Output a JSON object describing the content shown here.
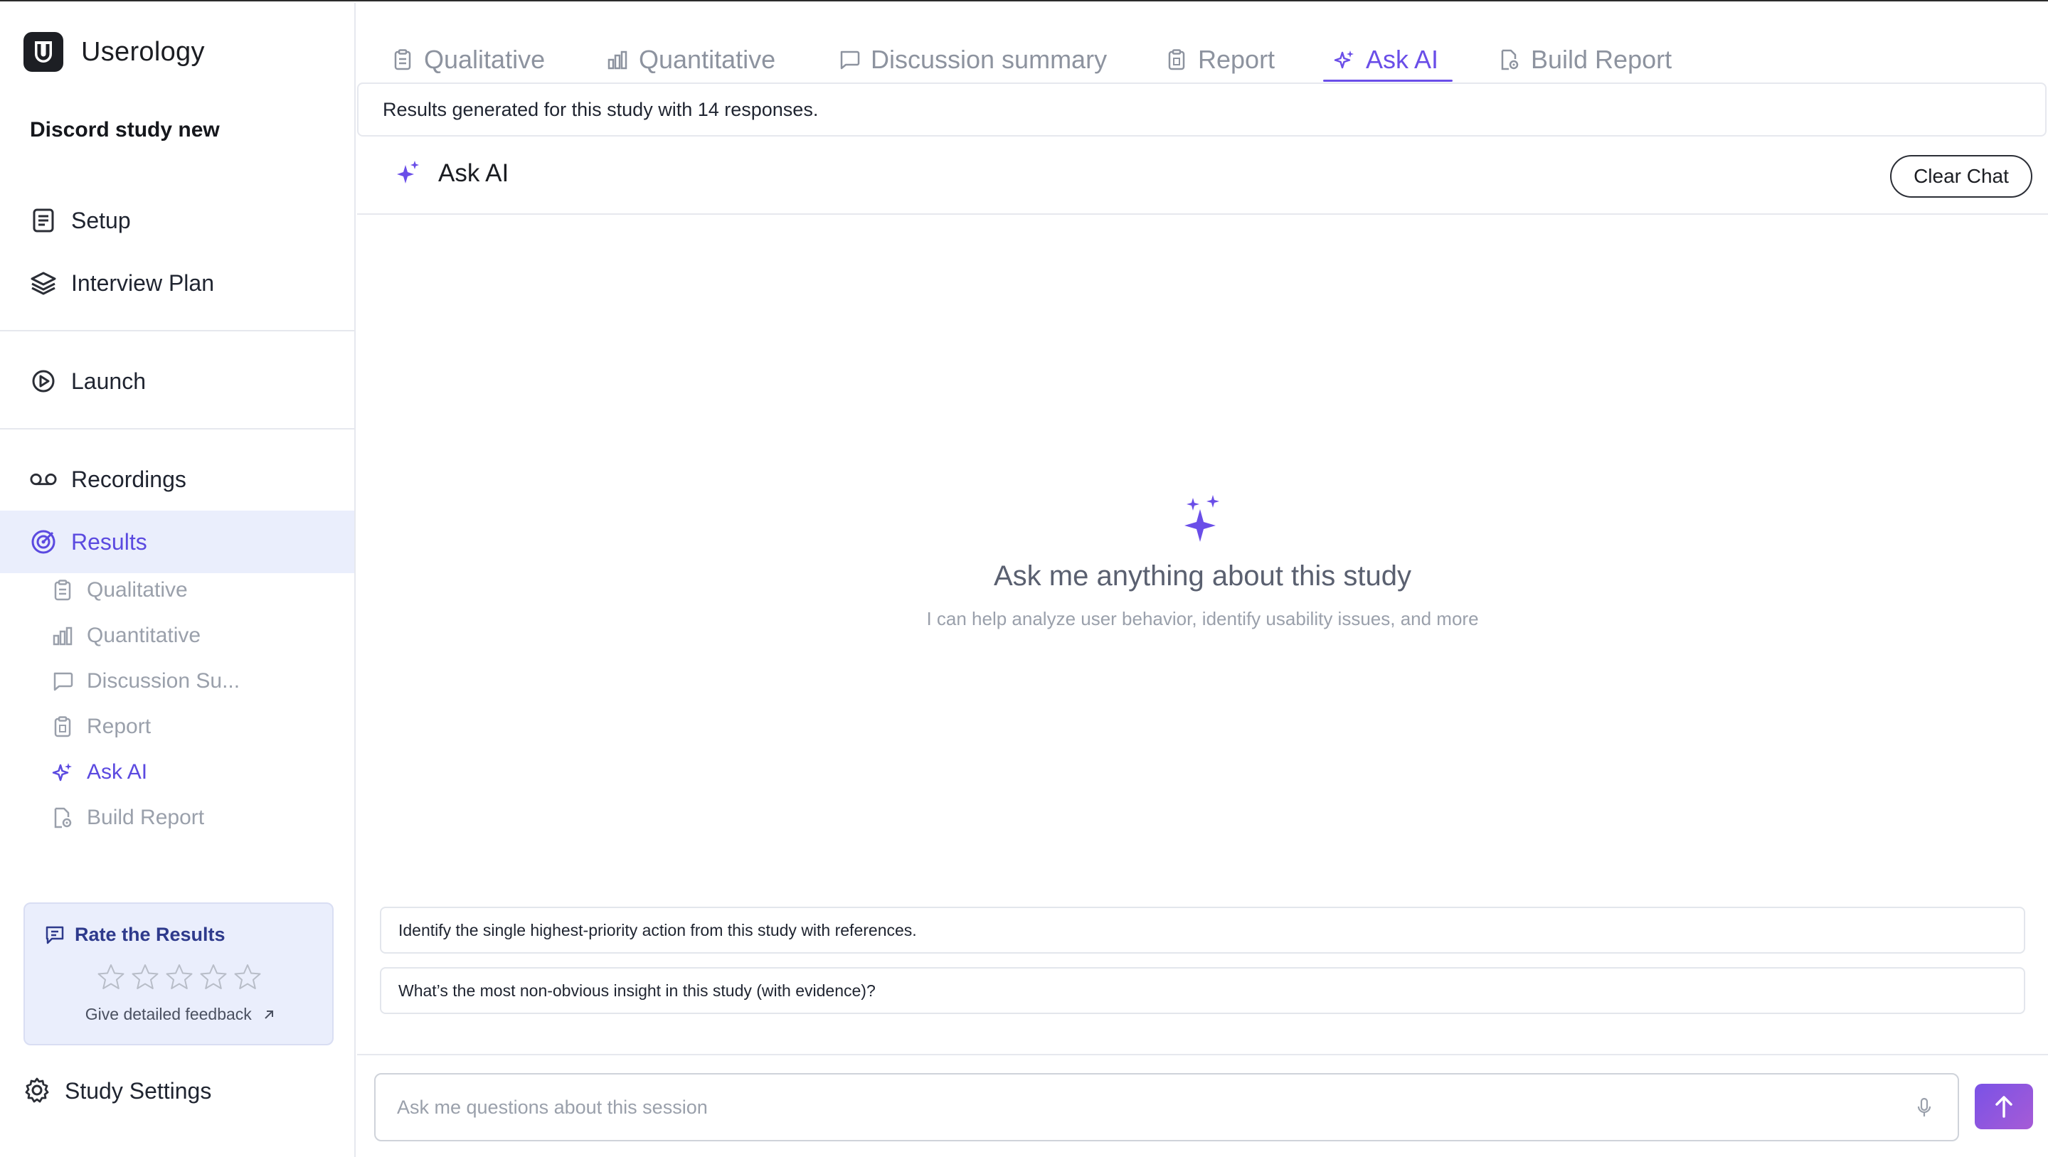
{
  "app": {
    "name": "Userology"
  },
  "study": {
    "name": "Discord study new"
  },
  "sidebar": {
    "nav": [
      {
        "label": "Setup",
        "icon": "document-icon"
      },
      {
        "label": "Interview Plan",
        "icon": "layers-icon"
      },
      {
        "label": "Launch",
        "icon": "play-circle-icon"
      },
      {
        "label": "Recordings",
        "icon": "voicemail-icon"
      },
      {
        "label": "Results",
        "icon": "target-icon",
        "active": true
      }
    ],
    "sub": [
      {
        "label": "Qualitative",
        "icon": "clipboard-icon"
      },
      {
        "label": "Quantitative",
        "icon": "bar-chart-icon"
      },
      {
        "label": "Discussion Su...",
        "icon": "chat-bubble-icon"
      },
      {
        "label": "Report",
        "icon": "clipboard-icon"
      },
      {
        "label": "Ask AI",
        "icon": "sparkles-icon",
        "active": true
      },
      {
        "label": "Build Report",
        "icon": "file-gear-icon"
      }
    ],
    "rate": {
      "title": "Rate the Results",
      "stars": 5,
      "rating": 0,
      "feedback_link": "Give detailed feedback"
    },
    "settings_label": "Study Settings"
  },
  "tabs": [
    {
      "label": "Qualitative",
      "icon": "clipboard-icon"
    },
    {
      "label": "Quantitative",
      "icon": "bar-chart-icon"
    },
    {
      "label": "Discussion summary",
      "icon": "chat-bubble-icon"
    },
    {
      "label": "Report",
      "icon": "clipboard-icon"
    },
    {
      "label": "Ask AI",
      "icon": "sparkles-icon",
      "active": true
    },
    {
      "label": "Build Report",
      "icon": "file-gear-icon"
    }
  ],
  "results_banner": "Results generated for this study with 14 responses.",
  "ask_ai": {
    "title": "Ask AI",
    "clear_label": "Clear Chat",
    "empty_title": "Ask me anything about this study",
    "empty_subtitle": "I can help analyze user behavior, identify usability issues, and more",
    "suggestions": [
      "Identify the single highest-priority action from this study with references.",
      "What’s the most non-obvious insight in this study (with evidence)?"
    ],
    "input_placeholder": "Ask me questions about this session"
  },
  "colors": {
    "accent": "#6a4ee8",
    "active_bg": "#eaeefc",
    "muted_text": "#9aa0ab"
  }
}
